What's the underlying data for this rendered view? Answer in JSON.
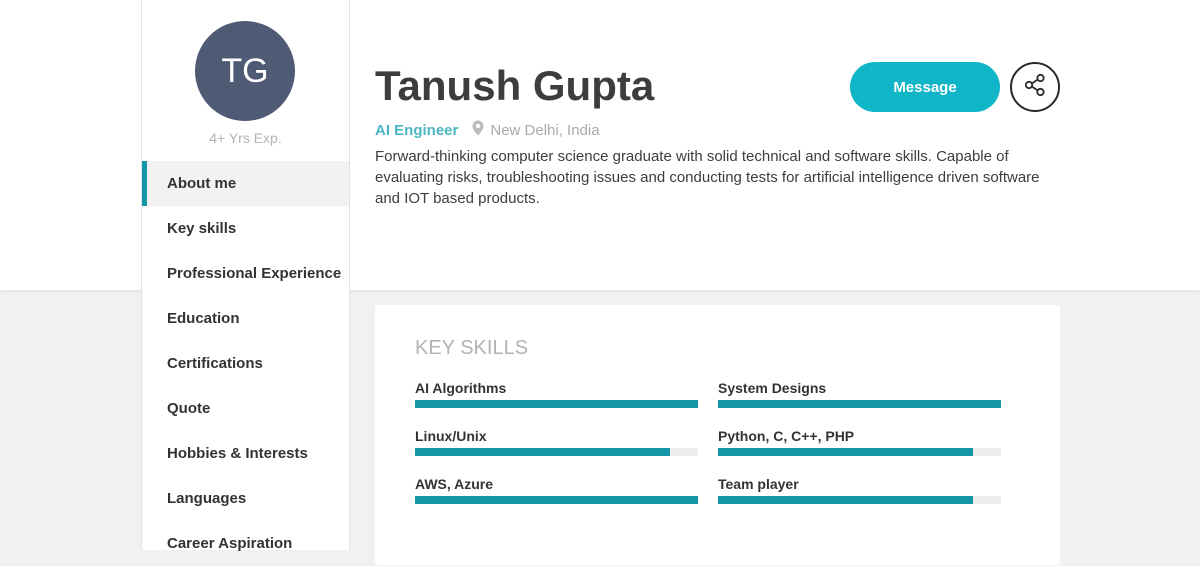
{
  "profile": {
    "initials": "TG",
    "experience": "4+ Yrs Exp.",
    "name": "Tanush Gupta",
    "role": "AI Engineer",
    "location": "New Delhi, India",
    "bio": "Forward-thinking computer science graduate with solid technical and software skills. Capable of evaluating risks, troubleshooting issues and conducting tests for artificial intelligence driven software and IOT based products."
  },
  "actions": {
    "message_label": "Message",
    "share_icon": "share-icon"
  },
  "nav": {
    "items": [
      {
        "label": "About me",
        "active": true
      },
      {
        "label": "Key skills",
        "active": false
      },
      {
        "label": "Professional Experience",
        "active": false
      },
      {
        "label": "Education",
        "active": false
      },
      {
        "label": "Certifications",
        "active": false
      },
      {
        "label": "Quote",
        "active": false
      },
      {
        "label": "Hobbies & Interests",
        "active": false
      },
      {
        "label": "Languages",
        "active": false
      },
      {
        "label": "Career Aspiration",
        "active": false
      }
    ]
  },
  "skills": {
    "title": "KEY SKILLS",
    "items": [
      {
        "label": "AI Algorithms",
        "level": 1.0
      },
      {
        "label": "System Designs",
        "level": 1.0
      },
      {
        "label": "Linux/Unix",
        "level": 0.9
      },
      {
        "label": "Python, C, C++, PHP",
        "level": 0.9
      },
      {
        "label": "AWS, Azure",
        "level": 1.0
      },
      {
        "label": "Team player",
        "level": 0.9
      }
    ]
  },
  "colors": {
    "accent": "#10b5c8",
    "bar": "#1596a6",
    "avatar": "#4f5a74",
    "role": "#4db6c4"
  }
}
